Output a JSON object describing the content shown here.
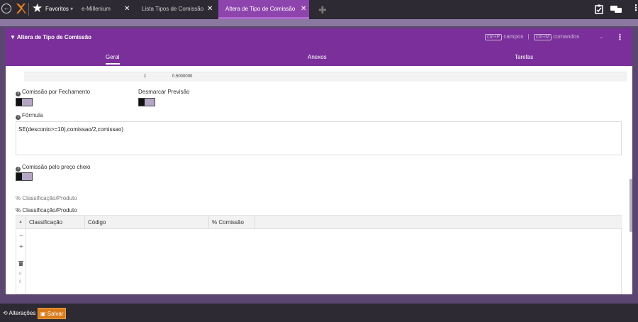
{
  "topbar": {
    "favorites_label": "Favoritos",
    "favorites_caret": "▾",
    "tabs": [
      {
        "label": "e-Millenium",
        "close": "✕"
      },
      {
        "label": "Lista Tipos de Comissão",
        "close": "✕"
      },
      {
        "label": "Altera de Tipo de Comissão",
        "close": "✕"
      }
    ],
    "add_tab": "✚"
  },
  "panel": {
    "title": "▼ Altera de Tipo de Comissão",
    "shortcut_campos_key": "ctrl+P",
    "shortcut_campos_label": "campos",
    "shortcut_sep": "|",
    "shortcut_comandos_key": "ctrl+M",
    "shortcut_comandos_label": "comandos",
    "tabs": [
      "Geral",
      "Anexos",
      "Tarefas"
    ]
  },
  "prev_row": {
    "c1": "1",
    "c2": "0.5000000"
  },
  "fields": {
    "comissao_fechamento": "Comissão por Fechamento",
    "desmarcar_previsao": "Desmarcar Previsão",
    "formula_label": "Fórmula",
    "formula_value": "SE(desconto>=10),comissao/2,comissao)",
    "preco_cheio": "Comissão pelo preço cheio"
  },
  "classification": {
    "section_title": "% Classificação/Produto",
    "sub_title": "% Classificação/Produto",
    "columns": [
      "Classificação",
      "Código",
      "% Comissão"
    ],
    "sort_glyph": "▲",
    "side_counts": [
      "0",
      "0"
    ]
  },
  "bottombar": {
    "alteracoes": "Alterações",
    "salvar": "Salvar"
  },
  "colors": {
    "accent": "#8e44ad",
    "header": "#7a2f9a",
    "save": "#d87b1c"
  }
}
